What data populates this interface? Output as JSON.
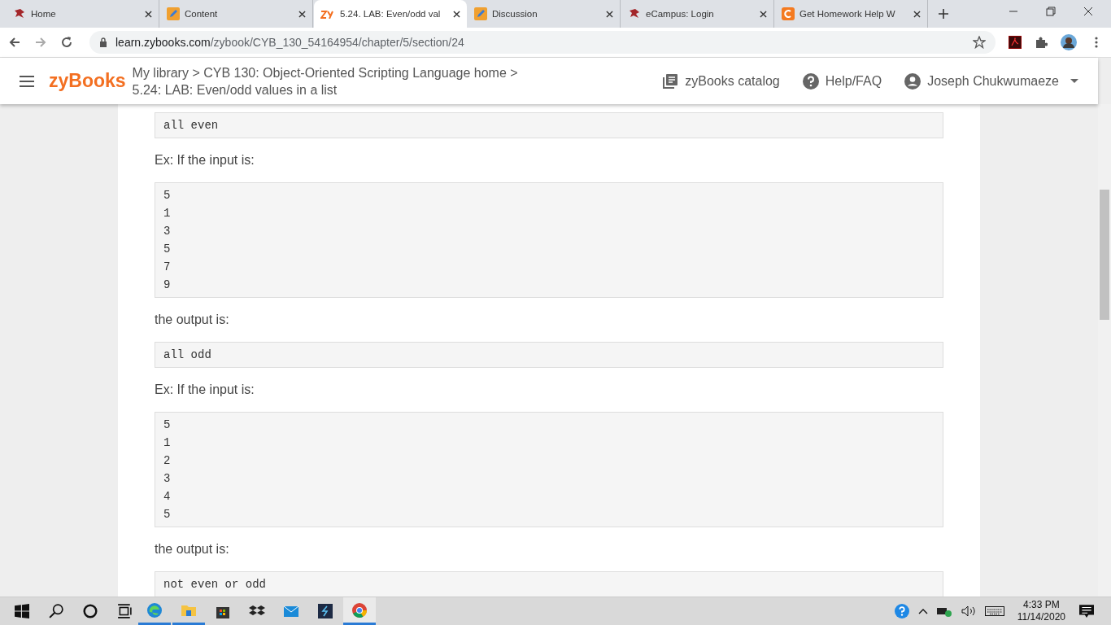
{
  "browser": {
    "tabs": [
      {
        "title": "Home",
        "selected": false
      },
      {
        "title": "Content",
        "selected": false
      },
      {
        "title": "5.24. LAB: Even/odd val",
        "selected": true
      },
      {
        "title": "Discussion",
        "selected": false
      },
      {
        "title": "eCampus: Login",
        "selected": false
      },
      {
        "title": "Get Homework Help W",
        "selected": false
      }
    ],
    "url_host": "learn.zybooks.com",
    "url_path": "/zybook/CYB_130_54164954/chapter/5/section/24"
  },
  "header": {
    "logo": "zyBooks",
    "breadcrumb_top": "My library > CYB 130: Object-Oriented Scripting Language home >",
    "breadcrumb_bottom": "5.24: LAB: Even/odd values in a list",
    "catalog": "zyBooks catalog",
    "help": "Help/FAQ",
    "user": "Joseph Chukwumaeze"
  },
  "content": [
    {
      "kind": "code",
      "lines": [
        "all even"
      ]
    },
    {
      "kind": "text",
      "text": "Ex: If the input is:"
    },
    {
      "kind": "code",
      "lines": [
        "5",
        "1",
        "3",
        "5",
        "7",
        "9"
      ]
    },
    {
      "kind": "text",
      "text": "the output is:"
    },
    {
      "kind": "code",
      "lines": [
        "all odd"
      ]
    },
    {
      "kind": "text",
      "text": "Ex: If the input is:"
    },
    {
      "kind": "code",
      "lines": [
        "5",
        "1",
        "2",
        "3",
        "4",
        "5"
      ]
    },
    {
      "kind": "text",
      "text": "the output is:"
    },
    {
      "kind": "code",
      "lines": [
        "not even or odd"
      ]
    }
  ],
  "taskbar": {
    "apps": [
      {
        "running": true,
        "selected": false
      },
      {
        "running": true,
        "selected": false
      },
      {
        "running": false,
        "selected": false
      },
      {
        "running": false,
        "selected": false
      },
      {
        "running": false,
        "selected": false
      },
      {
        "running": false,
        "selected": false
      },
      {
        "running": true,
        "selected": true
      }
    ],
    "time": "4:33 PM",
    "date": "11/14/2020"
  }
}
